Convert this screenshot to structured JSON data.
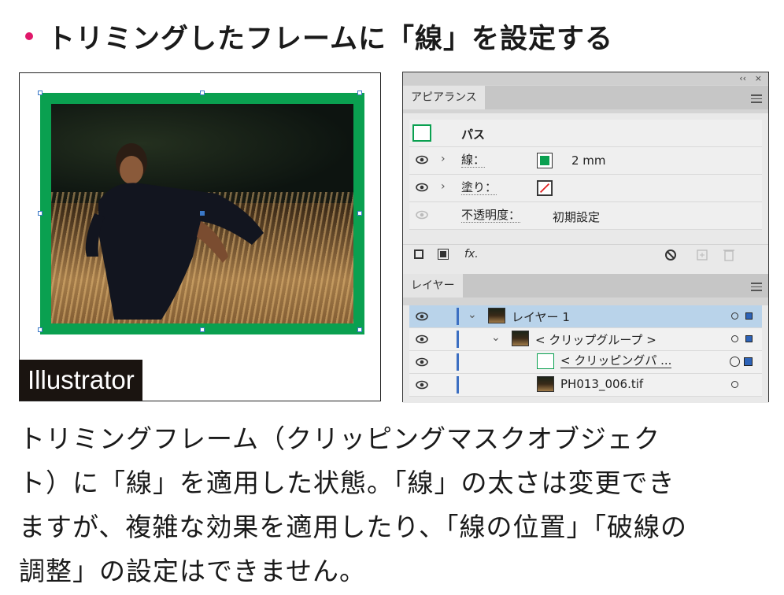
{
  "title": "トリミングしたフレームに「線」を設定する",
  "colors": {
    "bullet": "#e0186a",
    "frame_stroke": "#0aa050",
    "selection": "#3a78c8",
    "layer_selected": "#b9d3ea"
  },
  "artwork": {
    "badge": "Illustrator"
  },
  "panels": {
    "top_controls": {
      "collapse": "‹‹",
      "close": "×"
    },
    "appearance": {
      "tab": "アピアランス",
      "object_type": "パス",
      "rows": [
        {
          "label": "線：",
          "swatch": "green-stroke",
          "value": "2 mm"
        },
        {
          "label": "塗り：",
          "swatch": "none-fill",
          "value": ""
        },
        {
          "label": "不透明度：",
          "value": "初期設定"
        }
      ],
      "footer_icons": [
        "add-stroke-icon",
        "add-fill-icon",
        "fx-icon",
        "clear-icon",
        "duplicate-icon",
        "delete-icon"
      ],
      "fx_label": "fx."
    },
    "layers": {
      "tab": "レイヤー",
      "rows": [
        {
          "name": "レイヤー 1",
          "selected": true
        },
        {
          "name": "< クリップグループ >"
        },
        {
          "name": "< クリッピングパ ..."
        },
        {
          "name": "PH013_006.tif"
        }
      ]
    }
  },
  "caption": {
    "lines": [
      "トリミングフレーム（クリッピングマスクオブジェク",
      "ト）に「線」を適用した状態。「線」の太さは変更でき",
      "ますが、複雑な効果を適用したり、「線の位置」「破線の",
      "調整」の設定はできません。"
    ]
  }
}
